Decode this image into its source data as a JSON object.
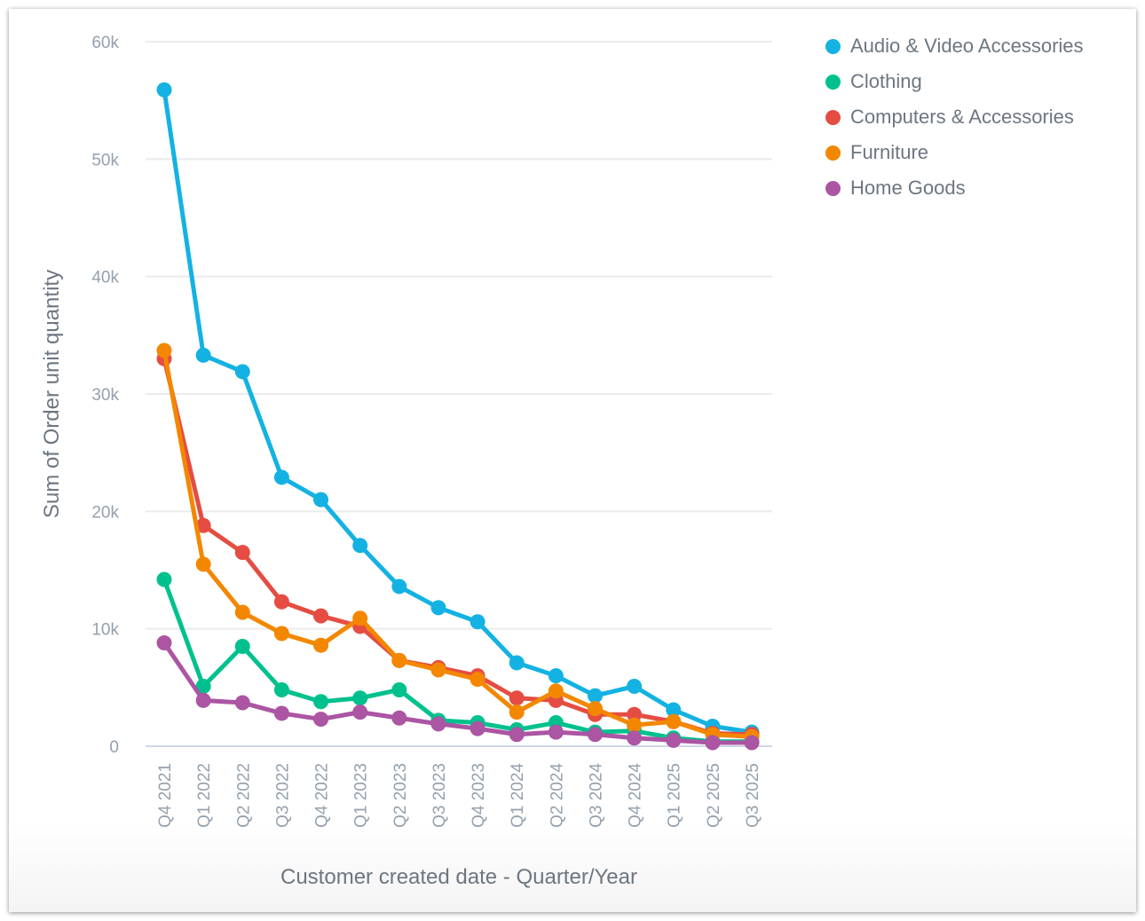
{
  "chart_data": {
    "type": "line",
    "title": "",
    "xlabel": "Customer created date - Quarter/Year",
    "ylabel": "Sum of Order unit quantity",
    "ylim": [
      0,
      60000
    ],
    "yticks": [
      0,
      10000,
      20000,
      30000,
      40000,
      50000,
      60000
    ],
    "ytick_labels": [
      "0",
      "10k",
      "20k",
      "30k",
      "40k",
      "50k",
      "60k"
    ],
    "grid": true,
    "legend_position": "top-right",
    "categories": [
      "Q4 2021",
      "Q1 2022",
      "Q2 2022",
      "Q3 2022",
      "Q4 2022",
      "Q1 2023",
      "Q2 2023",
      "Q3 2023",
      "Q4 2023",
      "Q1 2024",
      "Q2 2024",
      "Q3 2024",
      "Q4 2024",
      "Q1 2025",
      "Q2 2025",
      "Q3 2025"
    ],
    "series": [
      {
        "name": "Audio & Video Accessories",
        "color": "#14b2e2",
        "values": [
          55900,
          33300,
          31900,
          22900,
          21000,
          17100,
          13600,
          11800,
          10600,
          7100,
          6000,
          4300,
          5100,
          3100,
          1700,
          1200
        ]
      },
      {
        "name": "Clothing",
        "color": "#00c18d",
        "values": [
          14200,
          5100,
          8500,
          4800,
          3800,
          4100,
          4800,
          2200,
          2000,
          1400,
          2000,
          1200,
          1300,
          700,
          400,
          400
        ]
      },
      {
        "name": "Computers & Accessories",
        "color": "#e54d42",
        "values": [
          33000,
          18800,
          16500,
          12300,
          11100,
          10200,
          7300,
          6700,
          6000,
          4100,
          3900,
          2700,
          2700,
          2100,
          1100,
          1000
        ]
      },
      {
        "name": "Furniture",
        "color": "#f38700",
        "values": [
          33700,
          15500,
          11400,
          9600,
          8600,
          10900,
          7300,
          6500,
          5700,
          2900,
          4700,
          3200,
          1800,
          2100,
          1000,
          800
        ]
      },
      {
        "name": "Home Goods",
        "color": "#ab55a3",
        "values": [
          8800,
          3900,
          3700,
          2800,
          2300,
          2900,
          2400,
          1900,
          1500,
          1000,
          1200,
          1000,
          700,
          500,
          300,
          300
        ]
      }
    ]
  }
}
